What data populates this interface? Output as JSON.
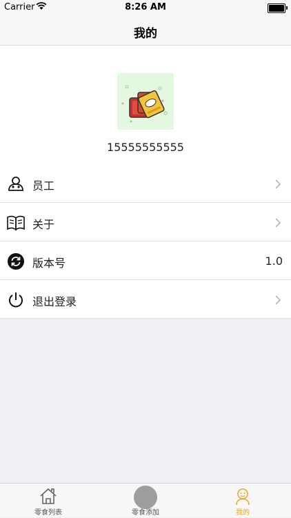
{
  "status_bar": {
    "carrier": "Carrier",
    "time": "8:26 AM"
  },
  "nav": {
    "title": "我的"
  },
  "profile": {
    "phone": "15555555555",
    "avatar_icon": "snack-package-avatar"
  },
  "menu": [
    {
      "label": "员工",
      "icon": "user-icon",
      "accessory": "chevron"
    },
    {
      "label": "关于",
      "icon": "book-icon",
      "accessory": "chevron"
    },
    {
      "label": "版本号",
      "icon": "refresh-icon",
      "value": "1.0"
    },
    {
      "label": "退出登录",
      "icon": "power-icon",
      "accessory": "chevron"
    }
  ],
  "tabs": [
    {
      "label": "零食列表",
      "icon": "home-icon",
      "active": false
    },
    {
      "label": "零食添加",
      "icon": "add-circle-icon",
      "active": false
    },
    {
      "label": "我的",
      "icon": "person-icon",
      "active": true
    }
  ],
  "colors": {
    "accent": "#e8a825",
    "background": "#efeff4",
    "avatar_bg": "#e4f7e0"
  }
}
